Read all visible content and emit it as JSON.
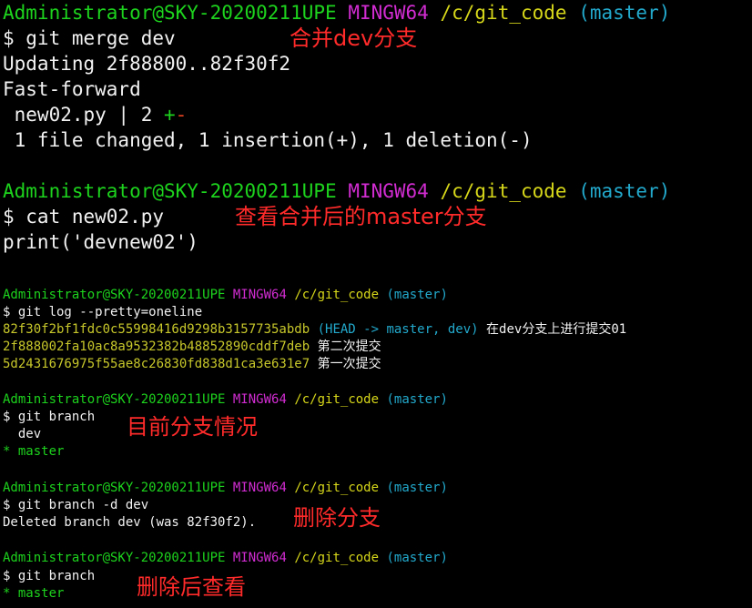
{
  "colors": {
    "background": "#000000",
    "user_host": "#1dd31d",
    "mingw": "#d12cd1",
    "path": "#d6d61a",
    "branch": "#22a9cc",
    "annotation": "#ff2a2a",
    "diff_plus": "#1dd31d",
    "diff_minus": "#e0401e"
  },
  "prompt": {
    "user_host": "Administrator@SKY-20200211UPE",
    "mingw": "MINGW64",
    "path": "/c/git_code",
    "branch": "(master)"
  },
  "block1": {
    "command": "$ git merge dev",
    "output_1": "Updating 2f88800..82f30f2",
    "output_2": "Fast-forward",
    "file_stat": " new02.py | 2 ",
    "plus": "+",
    "minus": "-",
    "summary": " 1 file changed, 1 insertion(+), 1 deletion(-)",
    "annotation": "合并dev分支"
  },
  "block2": {
    "command": "$ cat new02.py",
    "output": "print('devnew02')",
    "annotation": "查看合并后的master分支"
  },
  "block3": {
    "command": "$ git log --pretty=oneline",
    "commits": [
      {
        "hash": "82f30f2bf1fdc0c55998416d9298b3157735abdb",
        "refs": "(HEAD -> master, dev)",
        "message": "在dev分支上进行提交01"
      },
      {
        "hash": "2f888002fa10ac8a9532382b48852890cddf7deb",
        "refs": "",
        "message": "第二次提交"
      },
      {
        "hash": "5d2431676975f55ae8c26830fd838d1ca3e631e7",
        "refs": "",
        "message": "第一次提交"
      }
    ]
  },
  "block4": {
    "command": "$ git branch",
    "branch_dev": "  dev",
    "branch_master": "* master",
    "annotation": "目前分支情况"
  },
  "block5": {
    "command": "$ git branch -d dev",
    "output": "Deleted branch dev (was 82f30f2).",
    "annotation": "删除分支"
  },
  "block6": {
    "command": "$ git branch",
    "branch_master": "* master",
    "annotation": "删除后查看"
  }
}
